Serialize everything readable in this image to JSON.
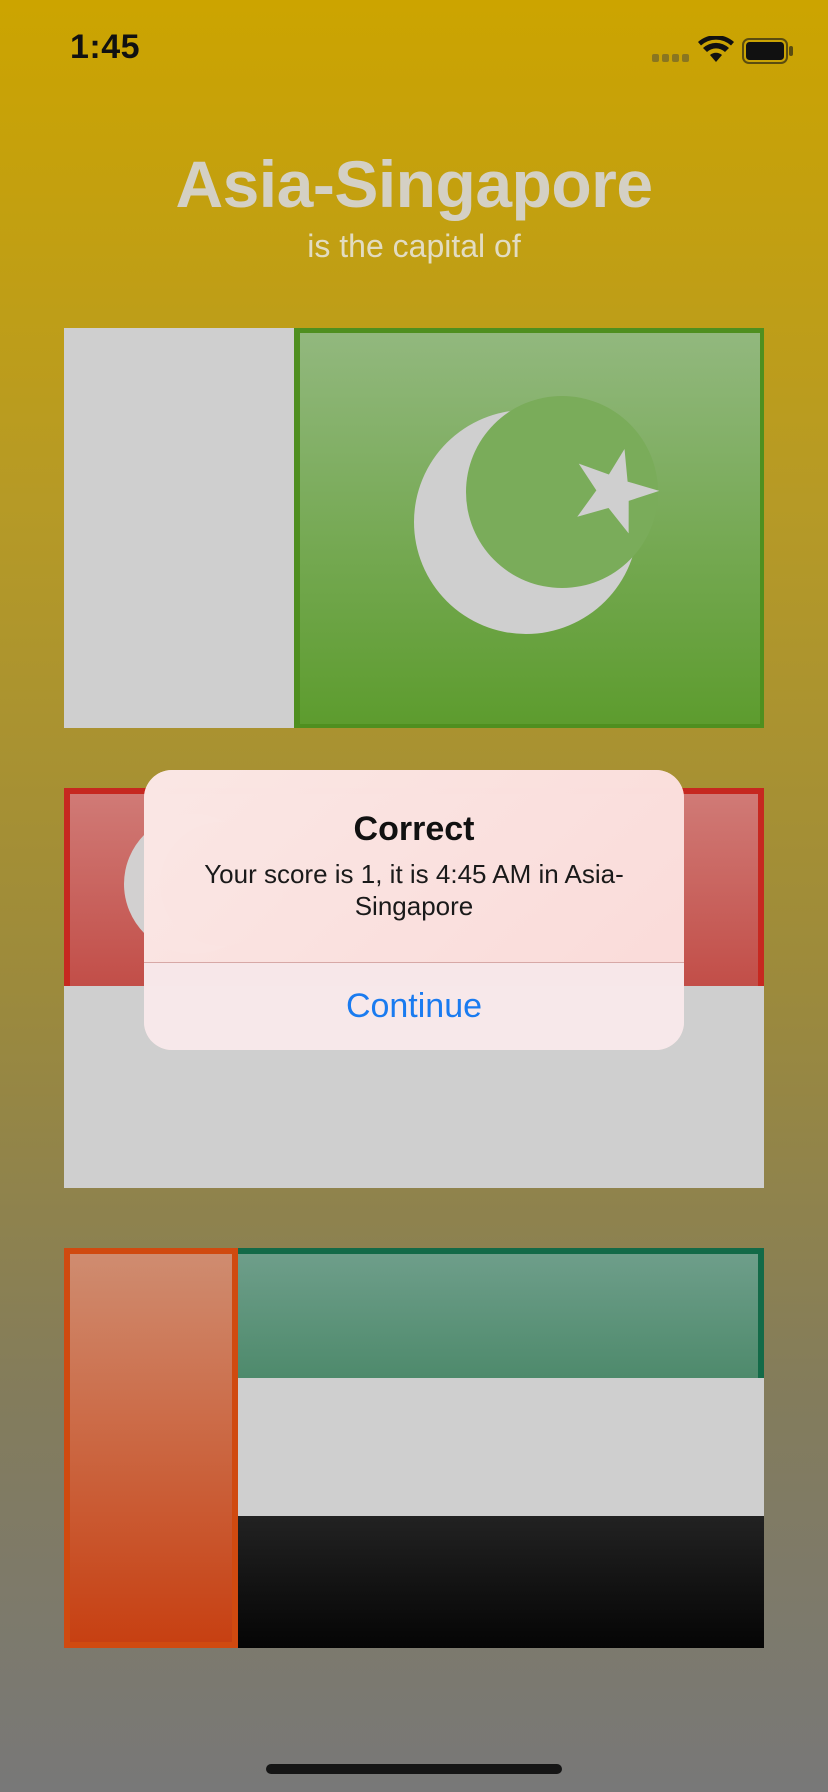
{
  "status_bar": {
    "time": "1:45"
  },
  "header": {
    "title": "Asia-Singapore",
    "subtitle": "is the capital of"
  },
  "flags": [
    {
      "icon": "pakistan-flag-icon"
    },
    {
      "icon": "singapore-flag-icon"
    },
    {
      "icon": "uae-flag-icon"
    }
  ],
  "alert": {
    "title": "Correct",
    "message": "Your score is 1, it is 4:45 AM in Asia-Singapore",
    "button_label": "Continue"
  },
  "colors": {
    "background_top": "#cca400",
    "background_bottom": "#787878",
    "accent": "#1a7bf0"
  }
}
